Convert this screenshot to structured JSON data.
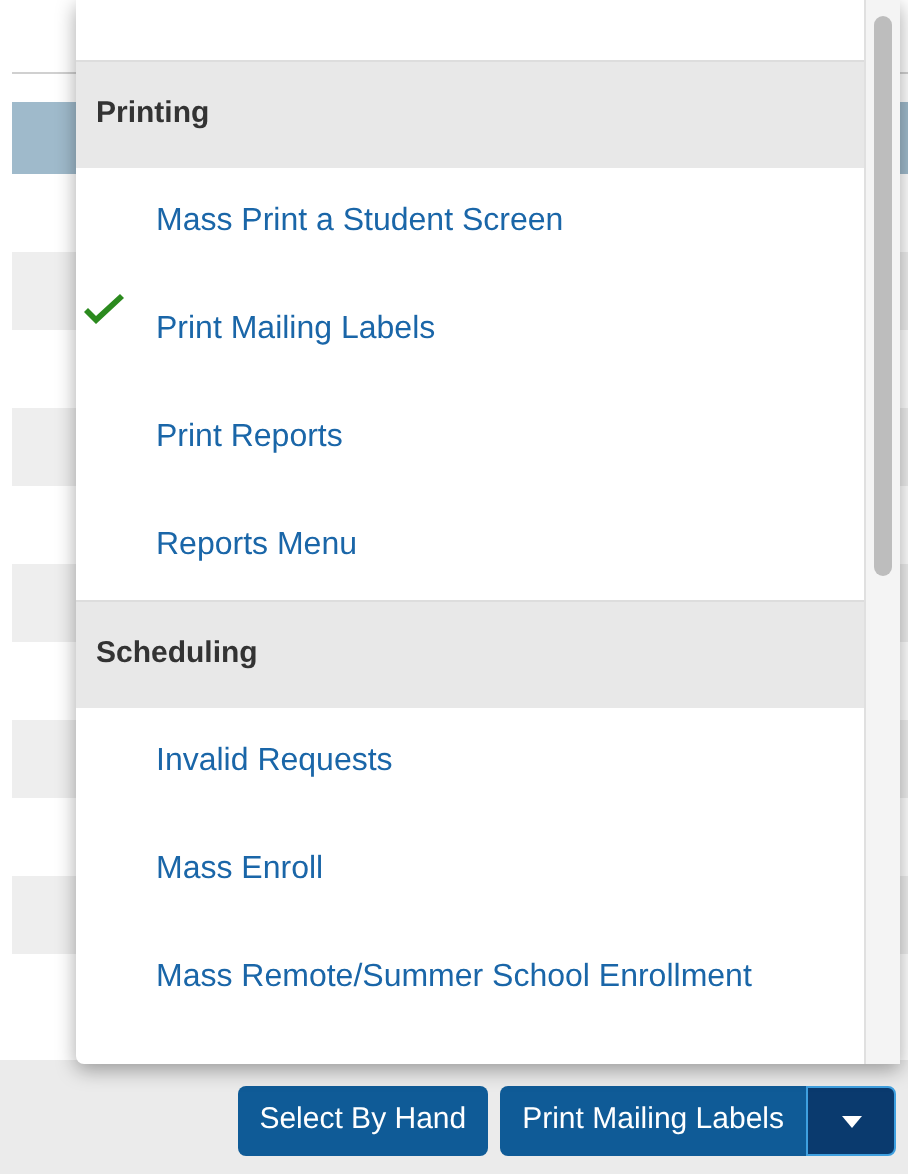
{
  "menu": {
    "sections": [
      {
        "title": "Printing",
        "items": [
          {
            "label": "Mass Print a Student Screen",
            "checked": false
          },
          {
            "label": "Print Mailing Labels",
            "checked": true
          },
          {
            "label": "Print Reports",
            "checked": false
          },
          {
            "label": "Reports Menu",
            "checked": false
          }
        ]
      },
      {
        "title": "Scheduling",
        "items": [
          {
            "label": "Invalid Requests",
            "checked": false
          },
          {
            "label": "Mass Enroll",
            "checked": false
          },
          {
            "label": "Mass Remote/Summer School Enrollment",
            "checked": false
          }
        ]
      }
    ]
  },
  "buttons": [
    "Select By Hand",
    "Print Mailing Labels"
  ]
}
